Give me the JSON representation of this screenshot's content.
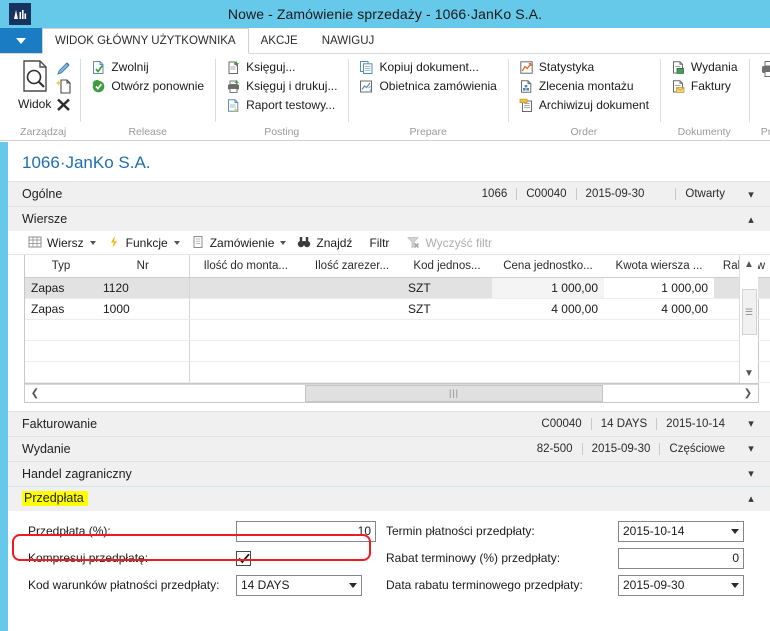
{
  "window": {
    "title": "Nowe - Zamówienie sprzedaży - 1066·JanKo S.A.",
    "logo_icon": "nav-logo-icon",
    "accent_blue": "#66c9ea",
    "ribbon_blue": "#1a7dc4"
  },
  "tabs": {
    "dropdown_icon": "chevron-down-icon",
    "items": [
      {
        "label": "WIDOK GŁÓWNY UŻYTKOWNIKA",
        "active": true
      },
      {
        "label": "AKCJE",
        "active": false
      },
      {
        "label": "NAWIGUJ",
        "active": false
      }
    ]
  },
  "ribbon": {
    "groups": [
      {
        "label": "Zarządzaj",
        "big_button": {
          "label": "Widok",
          "icon": "page-magnifier-icon"
        },
        "side_icons": [
          {
            "icon": "pencil-edit-icon"
          },
          {
            "icon": "new-page-icon"
          },
          {
            "icon": "delete-x-icon"
          }
        ],
        "items": []
      },
      {
        "label": "Release",
        "items": [
          {
            "label": "Zwolnij",
            "icon": "release-doc-icon"
          },
          {
            "label": "Otwórz ponownie",
            "icon": "reopen-circle-icon"
          }
        ]
      },
      {
        "label": "Posting",
        "items": [
          {
            "label": "Księguj...",
            "icon": "post-doc-icon"
          },
          {
            "label": "Księguj i drukuj...",
            "icon": "post-print-icon"
          },
          {
            "label": "Raport testowy...",
            "icon": "test-report-icon"
          }
        ]
      },
      {
        "label": "Prepare",
        "items": [
          {
            "label": "Kopiuj dokument...",
            "icon": "copy-document-icon"
          },
          {
            "label": "Obietnica zamówienia",
            "icon": "order-promise-icon"
          }
        ]
      },
      {
        "label": "Order",
        "items": [
          {
            "label": "Statystyka",
            "icon": "statistics-chart-icon"
          },
          {
            "label": "Zlecenia montażu",
            "icon": "assembly-orders-icon"
          },
          {
            "label": "Archiwizuj dokument",
            "icon": "archive-document-icon"
          }
        ]
      },
      {
        "label": "Dokumenty",
        "items": [
          {
            "label": "Wydania",
            "icon": "shipments-icon"
          },
          {
            "label": "Faktury",
            "icon": "invoices-icon"
          }
        ]
      },
      {
        "label": "Print",
        "items": [
          {
            "label": "",
            "icon": "printer-icon"
          }
        ]
      }
    ]
  },
  "page": {
    "doc_title": "1066·JanKo S.A."
  },
  "fasttabs": {
    "ogolne": {
      "name": "Ogólne",
      "values": [
        "1066",
        "C00040",
        "2015-09-30",
        "",
        "Otwarty"
      ],
      "chevron": "▾"
    },
    "wiersze": {
      "name": "Wiersze",
      "values": [],
      "chevron": "▴"
    },
    "fakturowanie": {
      "name": "Fakturowanie",
      "values": [
        "C00040",
        "14 DAYS",
        "2015-10-14"
      ],
      "chevron": "▾"
    },
    "wydanie": {
      "name": "Wydanie",
      "values": [
        "82-500",
        "2015-09-30",
        "Częściowe"
      ],
      "chevron": "▾"
    },
    "handel": {
      "name": "Handel zagraniczny",
      "values": [],
      "chevron": "▾"
    },
    "przedplata": {
      "name": "Przedpłata",
      "values": [],
      "chevron": "▴",
      "highlighted": true,
      "highlight_color": "#ffff00"
    }
  },
  "lines_toolbar": {
    "buttons": [
      {
        "label": "Wiersz",
        "icon": "grid-table-icon",
        "caret": true,
        "disabled": false
      },
      {
        "label": "Funkcje",
        "icon": "lightning-bolt-icon",
        "caret": true,
        "disabled": false
      },
      {
        "label": "Zamówienie",
        "icon": "order-doc-icon",
        "caret": true,
        "disabled": false
      },
      {
        "label": "Znajdź",
        "icon": "binoculars-icon",
        "caret": false,
        "disabled": false
      },
      {
        "label": "Filtr",
        "icon": "",
        "caret": false,
        "disabled": false
      },
      {
        "label": "Wyczyść filtr",
        "icon": "clear-filter-icon",
        "caret": false,
        "disabled": true
      }
    ]
  },
  "grid": {
    "columns": [
      {
        "label": "Typ",
        "align": "left"
      },
      {
        "label": "Nr",
        "align": "left"
      },
      {
        "label": "Ilość do monta...",
        "align": "right"
      },
      {
        "label": "Ilość zarezer...",
        "align": "right"
      },
      {
        "label": "Kod jednos...",
        "align": "left"
      },
      {
        "label": "Cena jednostko...",
        "align": "right"
      },
      {
        "label": "Kwota wiersza ...",
        "align": "right"
      },
      {
        "label": "Rabat w",
        "align": "left"
      }
    ],
    "rows": [
      {
        "selected": true,
        "cells": [
          "Zapas",
          "1120",
          "",
          "",
          "SZT",
          "1 000,00",
          "1 000,00",
          ""
        ]
      },
      {
        "selected": false,
        "cells": [
          "Zapas",
          "1000",
          "",
          "",
          "SZT",
          "4 000,00",
          "4 000,00",
          ""
        ]
      },
      {
        "selected": false,
        "cells": [
          "",
          "",
          "",
          "",
          "",
          "",
          "",
          ""
        ]
      },
      {
        "selected": false,
        "cells": [
          "",
          "",
          "",
          "",
          "",
          "",
          "",
          ""
        ]
      },
      {
        "selected": false,
        "cells": [
          "",
          "",
          "",
          "",
          "",
          "",
          "",
          ""
        ]
      }
    ],
    "vscroll": {
      "up_icon": "chevron-up-icon",
      "down_icon": "chevron-down-icon",
      "thumb_icon": "grip-icon"
    },
    "hscroll": {
      "left_icon": "chevron-left-icon",
      "right_icon": "chevron-right-icon",
      "thumb_icon": "grip-icon"
    }
  },
  "prepayment": {
    "left_fields": [
      {
        "label": "Przedpłata (%):",
        "value": "10",
        "type": "number-input",
        "name": "prepayment-percent"
      },
      {
        "label": "Kompresuj przedpłatę:",
        "value": "true",
        "type": "checkbox",
        "name": "compress-prepayment"
      },
      {
        "label": "Kod warunków płatności przedpłaty:",
        "value": "14 DAYS",
        "type": "select",
        "name": "prepayment-payment-terms-code"
      }
    ],
    "right_fields": [
      {
        "label": "Termin płatności przedpłaty:",
        "value": "2015-10-14",
        "type": "select",
        "name": "prepayment-due-date"
      },
      {
        "label": "Rabat terminowy (%) przedpłaty:",
        "value": "0",
        "type": "number-input",
        "name": "prepayment-discount-percent"
      },
      {
        "label": "Data rabatu terminowego przedpłaty:",
        "value": "2015-09-30",
        "type": "select",
        "name": "prepayment-discount-date"
      }
    ]
  },
  "annotations": {
    "highlight_color": "#ffff00",
    "callout_color": "#ee1b22"
  }
}
